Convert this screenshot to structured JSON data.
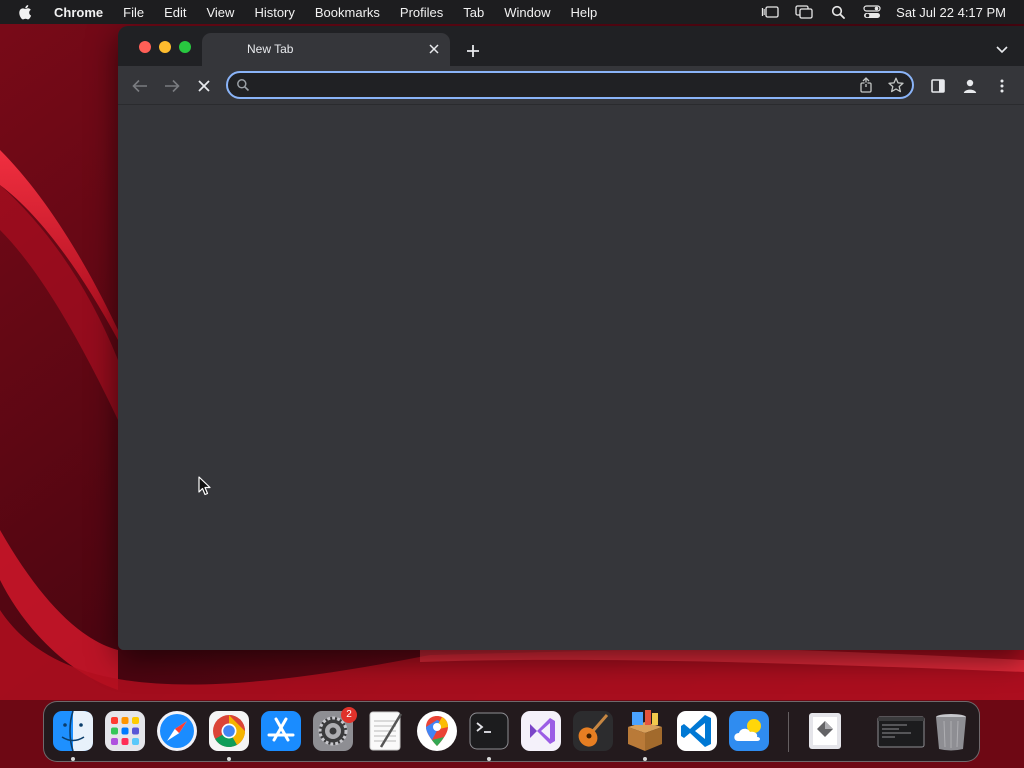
{
  "menubar": {
    "items": [
      "Chrome",
      "File",
      "Edit",
      "View",
      "History",
      "Bookmarks",
      "Profiles",
      "Tab",
      "Window",
      "Help"
    ],
    "clock": "Sat Jul 22  4:17 PM",
    "status_icons": [
      "stage-manager-icon",
      "screen-mirroring-icon",
      "spotlight-icon",
      "control-center-icon"
    ]
  },
  "browser": {
    "tab_title": "New Tab",
    "omnibox": {
      "value": "",
      "placeholder": ""
    },
    "reload_state": "stop",
    "theme": {
      "frame": "#202124",
      "toolbar": "#35363a",
      "accent": "#8ab4f8"
    }
  },
  "dock": {
    "apps": [
      "Finder",
      "Launchpad",
      "Safari",
      "Google Chrome",
      "App Store",
      "System Settings",
      "TextEdit",
      "Google Maps",
      "Terminal",
      "Visual Studio",
      "GarageBand",
      "Unarchiver",
      "Visual Studio Code",
      "Weather",
      "Preview",
      "Terminal Window",
      "Trash"
    ],
    "settings_badge": "2"
  }
}
